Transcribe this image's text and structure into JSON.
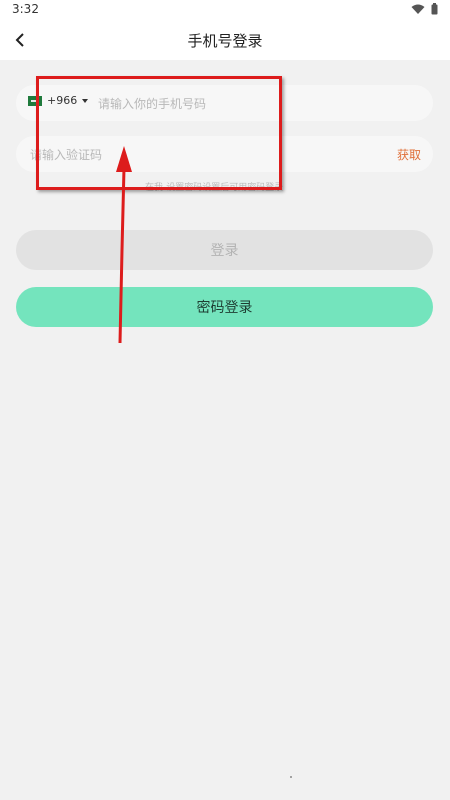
{
  "status_bar": {
    "time": "3:32",
    "icons": [
      "wifi-icon",
      "battery-icon"
    ]
  },
  "app_bar": {
    "back_icon": "chevron-left-icon",
    "title": "手机号登录"
  },
  "phone_field": {
    "country_code": "+966",
    "flag_icon": "saudi-flag-icon",
    "placeholder": "请输入你的手机号码",
    "value": ""
  },
  "code_field": {
    "placeholder": "请输入验证码",
    "value": "",
    "get_code_label": "获取"
  },
  "hint": "在我-设置密码设置后可用密码登录",
  "buttons": {
    "login": "登录",
    "password_login": "密码登录"
  },
  "colors": {
    "accent_green": "#74e4bd",
    "get_code_orange": "#e0703a",
    "annotation_red": "#dd1c1c",
    "disabled_gray": "#e2e2e2"
  }
}
